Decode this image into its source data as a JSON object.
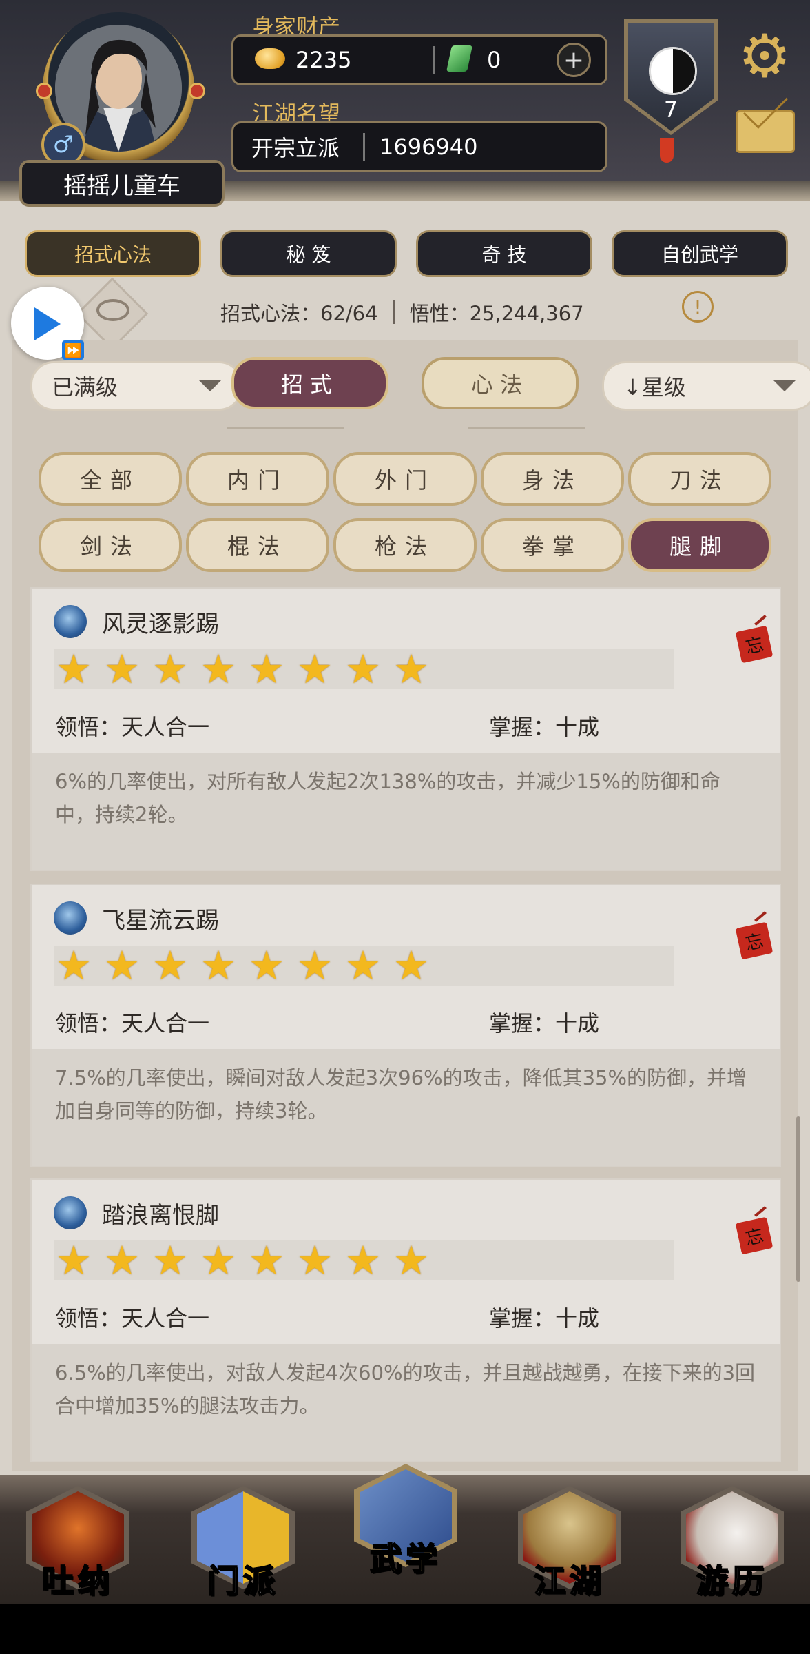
{
  "player": {
    "name": "摇摇儿童车",
    "gender_symbol": "♂"
  },
  "wealth": {
    "label": "身家财产",
    "gold": "2235",
    "jade": "0",
    "plus": "+"
  },
  "reputation": {
    "label": "江湖名望",
    "title": "开宗立派",
    "value": "1696940"
  },
  "rank": {
    "level": "7"
  },
  "icons": {
    "gear": "⚙",
    "info": "!",
    "ff": "⏩",
    "star": "★",
    "seal": "忘"
  },
  "top_tabs": [
    {
      "label": "招式心法",
      "active": true
    },
    {
      "label": "秘 笈",
      "active": false
    },
    {
      "label": "奇 技",
      "active": false
    },
    {
      "label": "自创武学",
      "active": false
    }
  ],
  "stats": {
    "moves": "招式心法：62/64",
    "insight": "悟性：25,244,367"
  },
  "filters": {
    "level_filter": "已满级",
    "sort_filter": "↓星级",
    "seg_moves": "招式",
    "seg_mind": "心法"
  },
  "categories": [
    {
      "label": "全部",
      "active": false
    },
    {
      "label": "内门",
      "active": false
    },
    {
      "label": "外门",
      "active": false
    },
    {
      "label": "身法",
      "active": false
    },
    {
      "label": "刀法",
      "active": false
    },
    {
      "label": "剑法",
      "active": false
    },
    {
      "label": "棍法",
      "active": false
    },
    {
      "label": "枪法",
      "active": false
    },
    {
      "label": "拳掌",
      "active": false
    },
    {
      "label": "腿脚",
      "active": true
    }
  ],
  "skills": [
    {
      "name": "风灵逐影踢",
      "stars": 8,
      "comprehension": "领悟：天人合一",
      "mastery": "掌握：十成",
      "desc": "6%的几率使出，对所有敌人发起2次138%的攻击，并减少15%的防御和命中，持续2轮。"
    },
    {
      "name": "飞星流云踢",
      "stars": 8,
      "comprehension": "领悟：天人合一",
      "mastery": "掌握：十成",
      "desc": "7.5%的几率使出，瞬间对敌人发起3次96%的攻击，降低其35%的防御，并增加自身同等的防御，持续3轮。"
    },
    {
      "name": "踏浪离恨脚",
      "stars": 8,
      "comprehension": "领悟：天人合一",
      "mastery": "掌握：十成",
      "desc": "6.5%的几率使出，对敌人发起4次60%的攻击，并且越战越勇，在接下来的3回合中增加35%的腿法攻击力。"
    }
  ],
  "bottom_nav": [
    {
      "label": "吐纳",
      "active": false
    },
    {
      "label": "门派",
      "active": false
    },
    {
      "label": "武学",
      "active": true
    },
    {
      "label": "江湖",
      "active": false
    },
    {
      "label": "游历",
      "active": false
    }
  ],
  "colors": {
    "accent_gold": "#e3b95c",
    "active_tab_plum": "#6e4150",
    "star": "#f3b81e"
  }
}
